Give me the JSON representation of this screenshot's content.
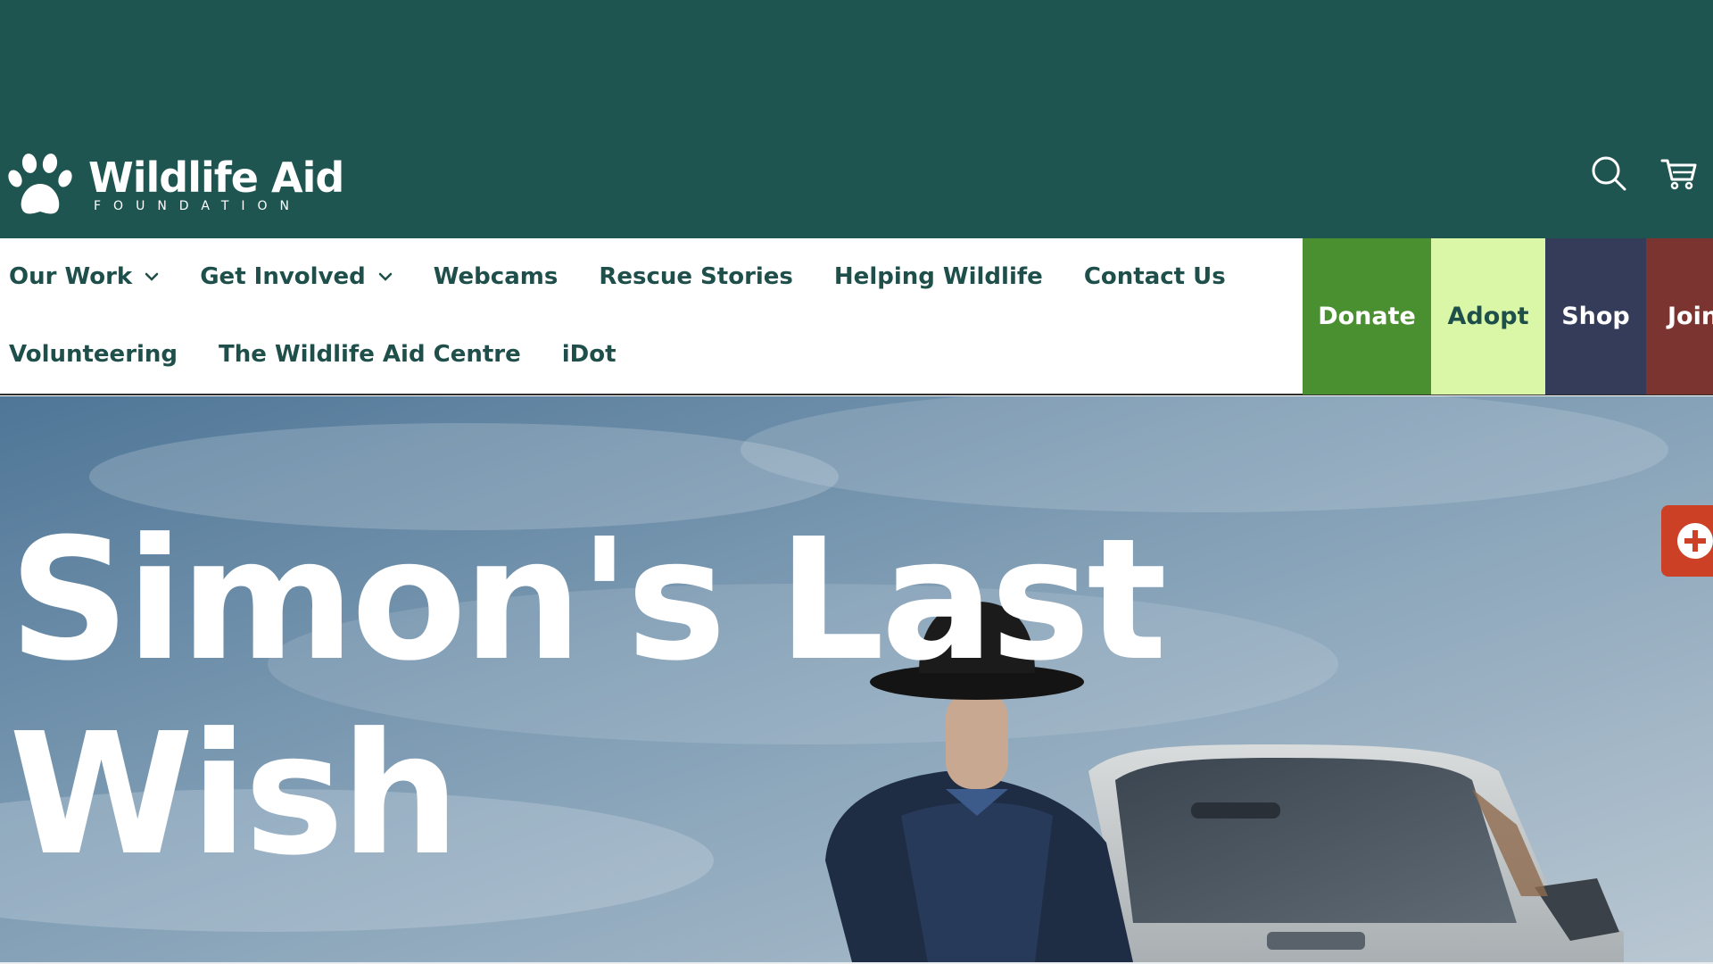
{
  "brand": {
    "name": "Wildlife Aid",
    "tagline": "FOUNDATION",
    "logo_icon": "paw-icon"
  },
  "header": {
    "search_icon": "search-icon",
    "cart_icon": "cart-icon"
  },
  "nav": {
    "row1": [
      {
        "label": "Our Work",
        "dropdown": true
      },
      {
        "label": "Get Involved",
        "dropdown": true
      },
      {
        "label": "Webcams"
      },
      {
        "label": "Rescue Stories"
      },
      {
        "label": "Helping Wildlife"
      },
      {
        "label": "Contact Us"
      }
    ],
    "row2": [
      {
        "label": "Volunteering"
      },
      {
        "label": "The Wildlife Aid Centre"
      },
      {
        "label": "iDot"
      }
    ]
  },
  "cta": {
    "donate": "Donate",
    "adopt": "Adopt",
    "shop": "Shop",
    "join": "Join"
  },
  "hero": {
    "title": "Simon's Last Wish"
  },
  "colors": {
    "header_bg": "#1f5550",
    "nav_text": "#1f4f4a",
    "donate": "#4b9030",
    "adopt": "#d9f7a6",
    "shop": "#353c5a",
    "join": "#7c3431",
    "side_tab": "#cc4125"
  },
  "side_tab": {
    "icon": "plus-circle-icon"
  }
}
